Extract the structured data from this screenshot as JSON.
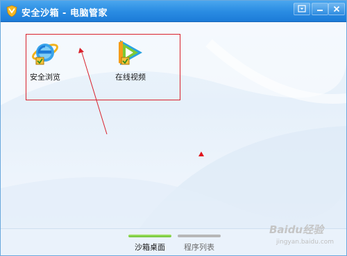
{
  "window": {
    "title": "安全沙箱 - 电脑管家"
  },
  "desktop": {
    "icons": [
      {
        "label": "安全浏览",
        "icon": "ie-browser-icon"
      },
      {
        "label": "在线视频",
        "icon": "video-play-icon"
      }
    ]
  },
  "tabs": [
    {
      "label": "沙箱桌面",
      "active": true
    },
    {
      "label": "程序列表",
      "active": false
    }
  ],
  "watermark": {
    "main": "Baidu经验",
    "sub": "jingyan.baidu.com"
  },
  "colors": {
    "titlebar": "#2b8de3",
    "annotation": "#d9202a",
    "active_tab": "#6cc232",
    "inactive_tab": "#b7b7b7"
  }
}
